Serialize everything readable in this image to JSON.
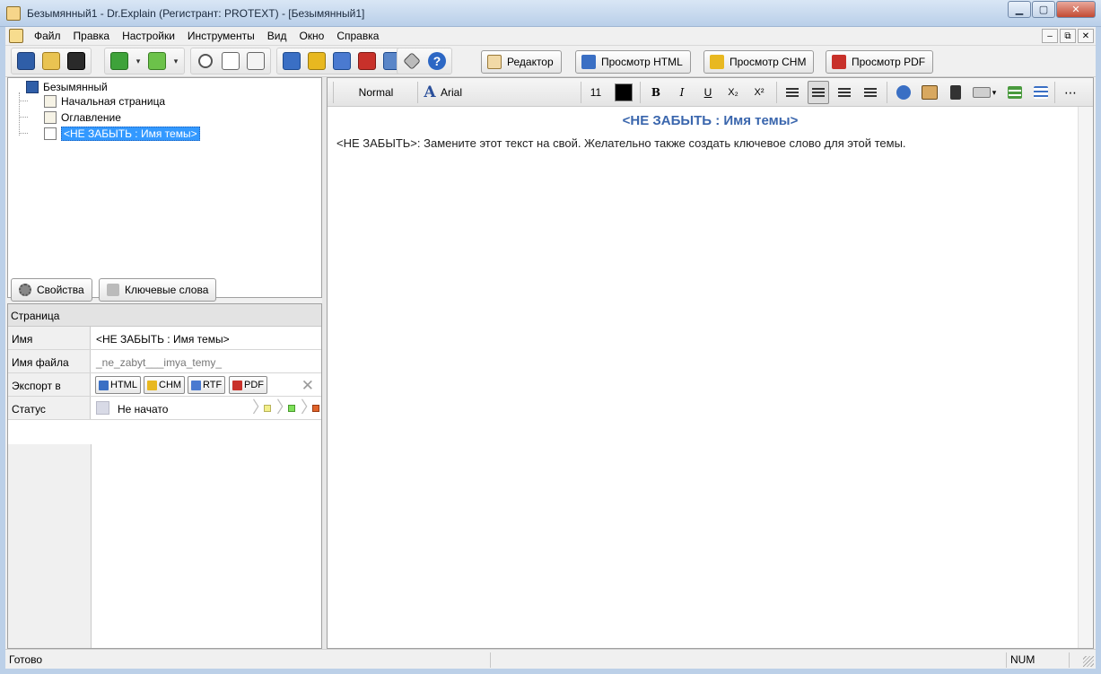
{
  "window": {
    "title": "Безымянный1 - Dr.Explain (Регистрант: PROTEXT) - [Безымянный1]",
    "minimize_glyph": "▁",
    "maximize_glyph": "▢",
    "close_glyph": "✕"
  },
  "menu": {
    "items": [
      {
        "label": "Файл"
      },
      {
        "label": "Правка"
      },
      {
        "label": "Настройки"
      },
      {
        "label": "Инструменты"
      },
      {
        "label": "Вид"
      },
      {
        "label": "Окно"
      },
      {
        "label": "Справка"
      }
    ],
    "mdi": {
      "minimize": "–",
      "restore": "⧉",
      "close": "✕"
    }
  },
  "toolbar": {
    "icons": [
      "new-project-icon",
      "open-icon",
      "save-icon",
      "add-topic-icon",
      "add-child-topic-icon",
      "cut-icon",
      "copy-icon",
      "paste-icon",
      "export-html-icon",
      "export-chm-icon",
      "export-rtf-icon",
      "export-pdf-icon",
      "export-all-icon",
      "settings-tools-icon",
      "help-icon"
    ],
    "colors": {
      "blue": "#3a6fc4",
      "green": "#3ea23a",
      "red": "#c8312a",
      "yellow": "#e8b820"
    },
    "dropdown_glyph": "▾",
    "help_glyph": "?",
    "modes": [
      {
        "label": "Редактор"
      },
      {
        "label": "Просмотр HTML"
      },
      {
        "label": "Просмотр CHM"
      },
      {
        "label": "Просмотр PDF"
      }
    ]
  },
  "tree": {
    "root": "Безымянный",
    "items": [
      {
        "label": "Начальная страница"
      },
      {
        "label": "Оглавление"
      },
      {
        "label": "<НЕ ЗАБЫТЬ : Имя темы>"
      }
    ]
  },
  "props": {
    "tabs": [
      {
        "label": "Свойства"
      },
      {
        "label": "Ключевые слова"
      }
    ],
    "header": "Страница",
    "rows": {
      "name_key": "Имя",
      "name_value": "<НЕ ЗАБЫТЬ : Имя темы>",
      "file_key": "Имя файла",
      "file_value": "_ne_zabyt___imya_temy_",
      "export_key": "Экспорт в",
      "export_buttons": [
        "HTML",
        "CHM",
        "RTF",
        "PDF"
      ],
      "clear_glyph": "✕",
      "status_key": "Статус",
      "status_value": "Не начато"
    },
    "status_colors": {
      "not_started": "#d8dae6",
      "stage1": "#f3ef8a",
      "stage2": "#7ee05a",
      "stage3": "#e0632a"
    }
  },
  "editor": {
    "style_value": "Normal",
    "font_glyph": "A",
    "font_value": "Arial",
    "font_size": "11",
    "text_color": "#000000",
    "bold": "B",
    "italic": "I",
    "underline": "U",
    "subscript": "X₂",
    "superscript": "X²",
    "more": "⋯",
    "heading": "<НЕ ЗАБЫТЬ : Имя темы>",
    "body": "<НЕ ЗАБЫТЬ>: Замените этот текст на свой. Желательно также создать ключевое слово для этой темы."
  },
  "statusbar": {
    "status_text": "Готово",
    "num": "NUM"
  }
}
